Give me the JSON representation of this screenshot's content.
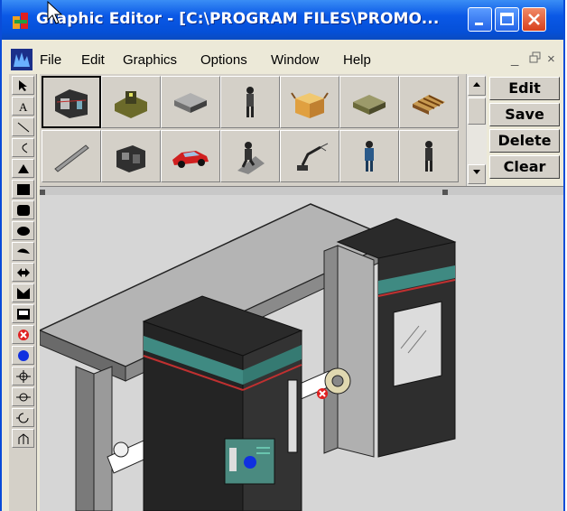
{
  "window": {
    "title": "Graphic Editor - [C:\\PROGRAM FILES\\PROMO...",
    "accent_color": "#0a58e6",
    "close_color": "#d8401c"
  },
  "menubar": {
    "items": [
      "File",
      "Edit",
      "Graphics",
      "Options",
      "Window",
      "Help"
    ],
    "mdi_controls": [
      "_",
      "̄□",
      "×"
    ]
  },
  "left_toolbar": {
    "tools": [
      "pointer-tool",
      "text-tool",
      "line-tool",
      "arc-tool",
      "triangle-tool",
      "filled-rect-tool",
      "rounded-rect-tool",
      "ellipse-tool",
      "half-ellipse-tool",
      "double-arrow-tool",
      "chevron-shape-tool",
      "outline-rect-tool",
      "delete-marker-tool",
      "blue-dot-tool",
      "connector-tool",
      "junction-tool",
      "rotate-tool",
      "flow-tool"
    ]
  },
  "palette": {
    "row1": [
      "cnc-machine",
      "lathe-machine",
      "flat-slab",
      "worker-figure",
      "open-box",
      "pallet-box",
      "wood-pallet"
    ],
    "row2": [
      "rod-bar",
      "engine-block",
      "red-car",
      "worker-on-slope",
      "robot-arm",
      "blue-worker",
      "standing-worker"
    ]
  },
  "actions": {
    "edit": "Edit",
    "save": "Save",
    "delete": "Delete",
    "clear": "Clear"
  }
}
